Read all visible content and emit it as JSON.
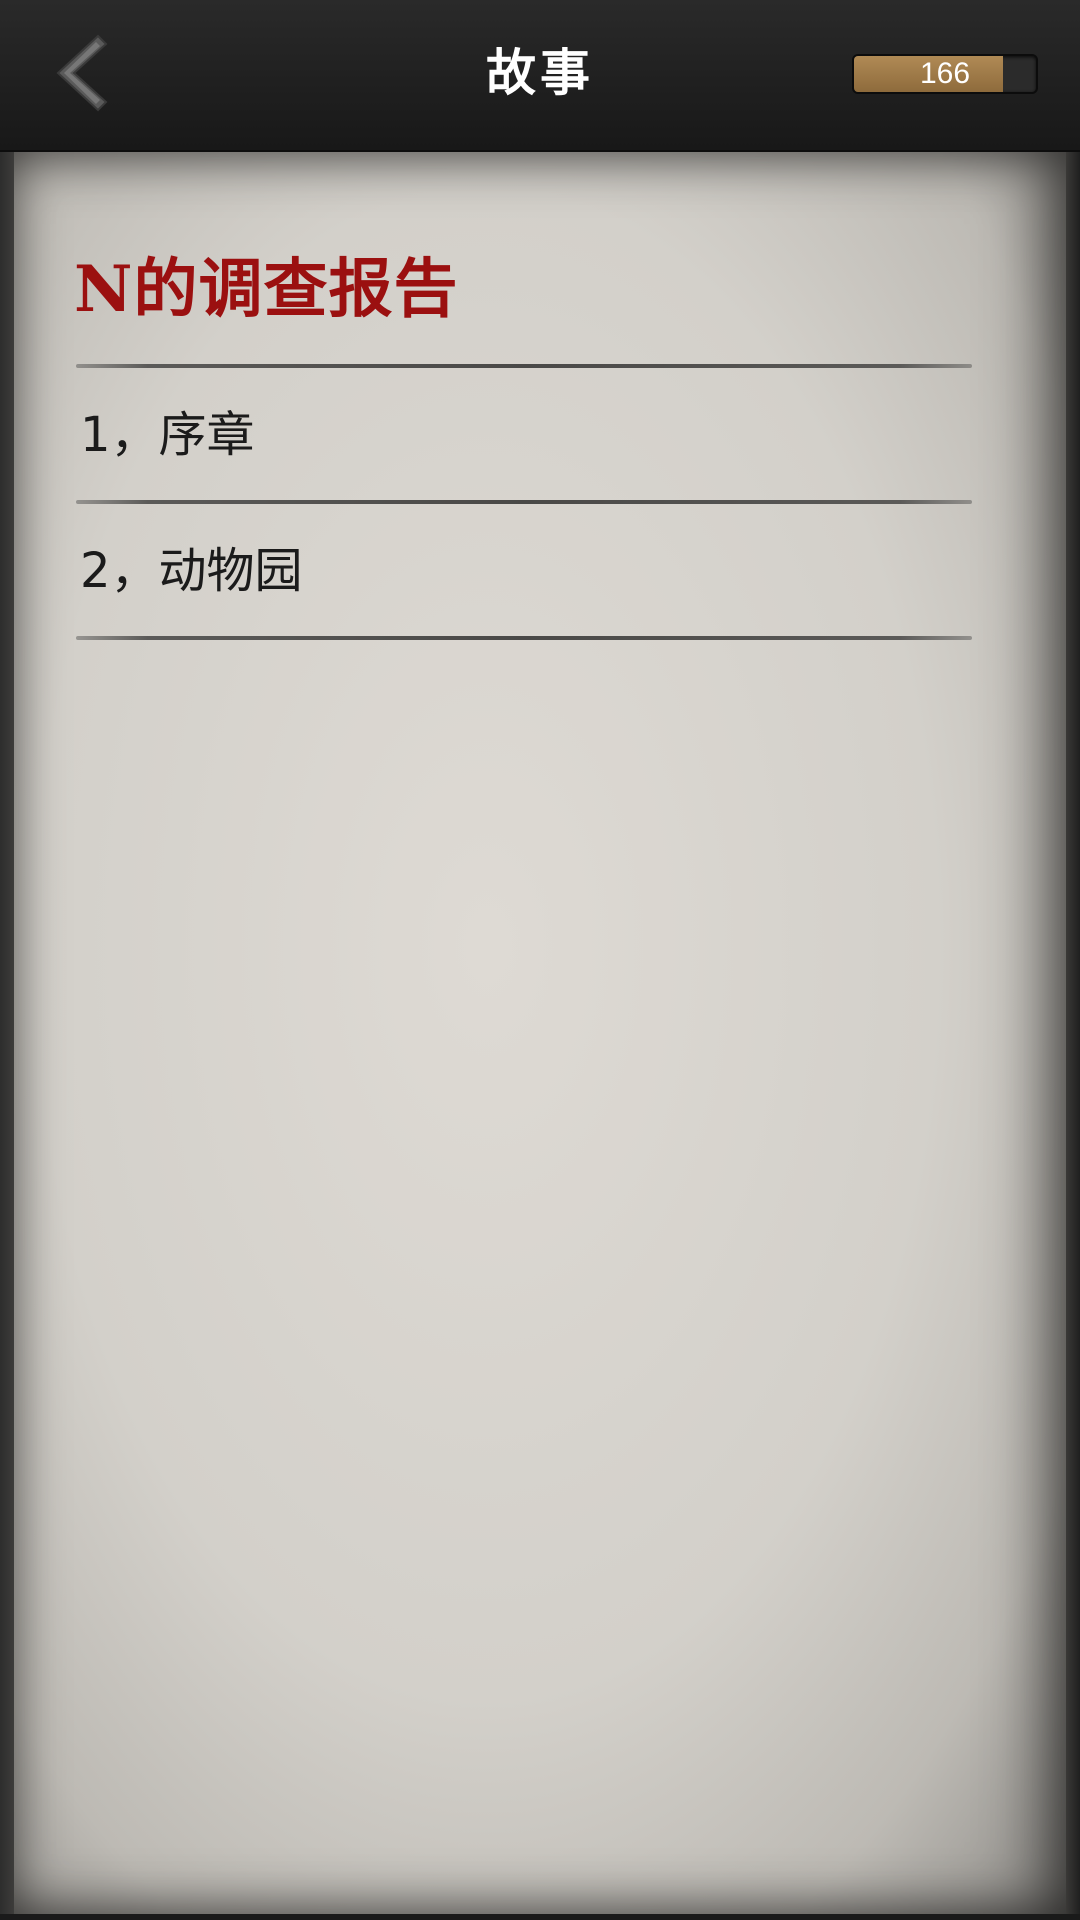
{
  "header": {
    "title": "故事",
    "back_icon": "chevron-left-icon",
    "counter": {
      "value": "166",
      "fill_fraction": 0.82,
      "fill_color": "#a07d4a"
    }
  },
  "story": {
    "title": "N的调查报告",
    "title_color": "#9b1010",
    "chapters": [
      {
        "label": "1，序章"
      },
      {
        "label": "2，动物园"
      }
    ]
  }
}
